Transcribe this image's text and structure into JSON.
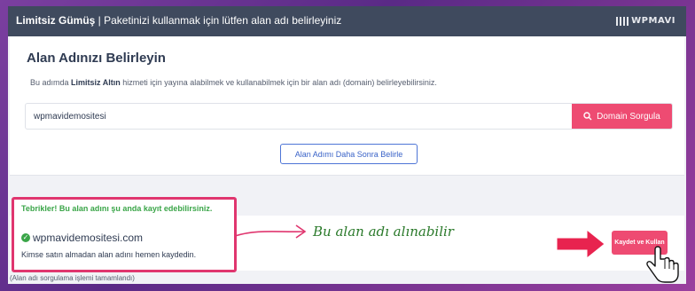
{
  "header": {
    "title_bold": "Limitsiz Gümüş",
    "title_rest": " | Paketinizi kullanmak için lütfen alan adı belirleyiniz",
    "brand": "WPMAVI"
  },
  "card": {
    "heading": "Alan Adınızı Belirleyin",
    "desc_prefix": "Bu adımda ",
    "desc_bold": "Limitsiz Altın",
    "desc_suffix": "  hizmeti için yayına alabilmek ve kullanabilmek için bir alan adı (domain) belirleyebilirsiniz.",
    "search_value": "wpmavidemositesi",
    "search_button": "Domain Sorgula",
    "later_button": "Alan Adımı Daha Sonra Belirle"
  },
  "result": {
    "congrats": "Tebrikler! Bu alan adını şu anda kayıt edebilirsiniz.",
    "domain": "wpmavidemositesi.com",
    "note": "Kimse satın almadan alan adını hemen kaydedin.",
    "save_button": "Kaydet ve Kullan"
  },
  "annotation": "Bu alan adı alınabilir",
  "footer": "(Alan adı sorgulama işlemi tamamlandı)",
  "colors": {
    "header_bg": "#3f4a5e",
    "accent_pink": "#ee4b72",
    "success_green": "#3aa548",
    "outline_blue": "#4e75d6",
    "highlight_border": "#e0366f"
  },
  "icons": [
    "wpmavi-logo-icon",
    "search-icon",
    "check-circle-icon",
    "annotation-arrow-icon",
    "pointer-arrow-icon",
    "hand-cursor-icon"
  ]
}
